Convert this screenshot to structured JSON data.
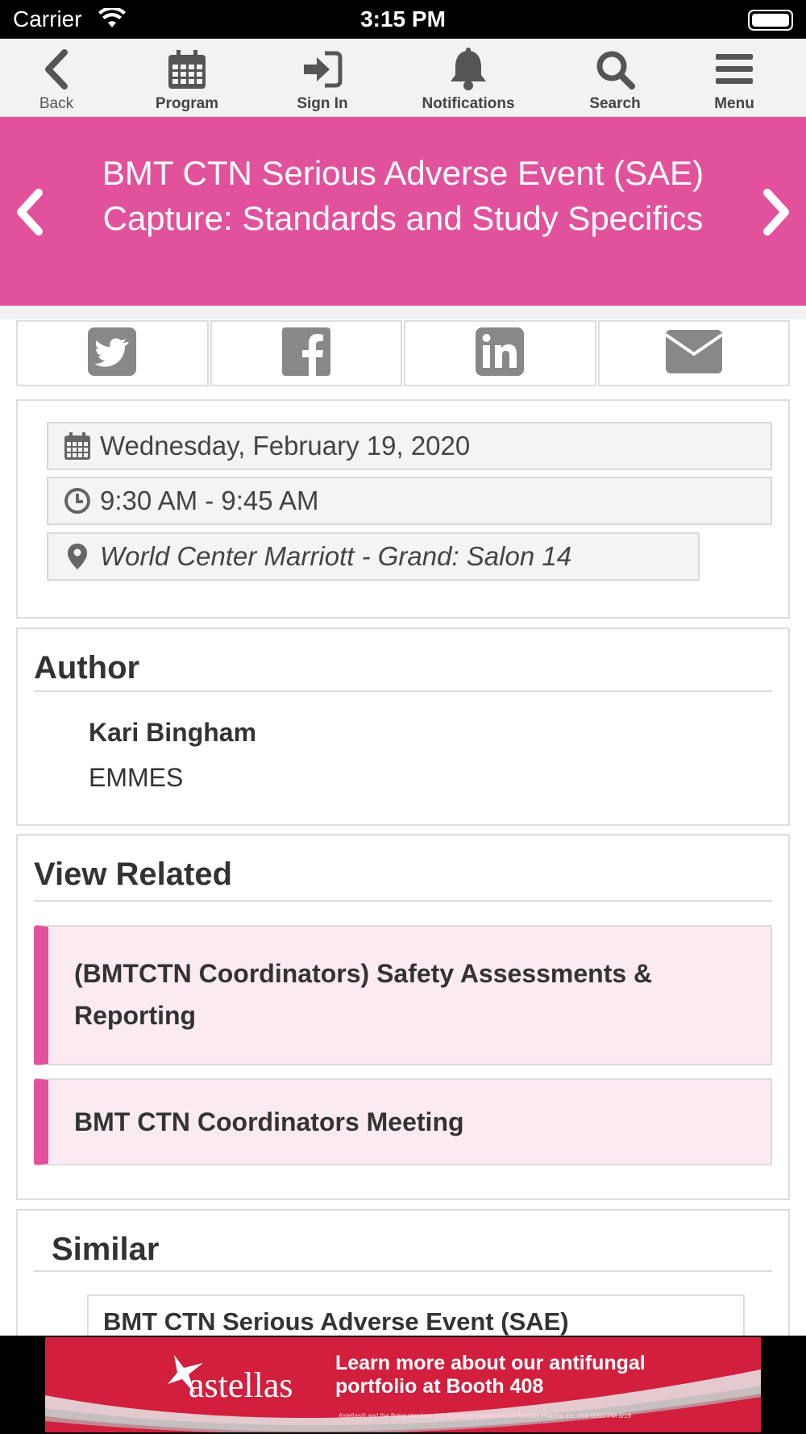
{
  "status": {
    "carrier": "Carrier",
    "time": "3:15 PM"
  },
  "toolbar": {
    "back": "Back",
    "program": "Program",
    "sign_in": "Sign In",
    "notifications": "Notifications",
    "search": "Search",
    "menu": "Menu"
  },
  "session": {
    "title": "BMT CTN Serious Adverse Event (SAE) Capture: Standards and Study Specifics",
    "date": "Wednesday, February 19, 2020",
    "time": "9:30 AM - 9:45 AM",
    "location": "World Center Marriott - Grand: Salon 14"
  },
  "share": [
    "twitter-icon",
    "facebook-icon",
    "linkedin-icon",
    "email-icon"
  ],
  "author": {
    "heading": "Author",
    "name": "Kari Bingham",
    "org": "EMMES"
  },
  "related": {
    "heading": "View Related",
    "items": [
      {
        "title": "(BMTCTN Coordinators) Safety Assessments & Reporting"
      },
      {
        "title": "BMT CTN Coordinators Meeting"
      }
    ]
  },
  "similar": {
    "heading": "Similar",
    "items": [
      {
        "title": "BMT CTN Serious Adverse Event (SAE)"
      }
    ]
  },
  "ad": {
    "brand": "astellas",
    "message": "Learn more about our antifungal portfolio at Booth 408",
    "fine_print": "Astellas® and the flying star logo are registered trademarks of Astellas Pharma Inc. 058-0083-PM 3/19"
  },
  "colors": {
    "accent": "#e2529c",
    "related_bg": "#faebf3",
    "ad_bg": "#d11f3d"
  }
}
